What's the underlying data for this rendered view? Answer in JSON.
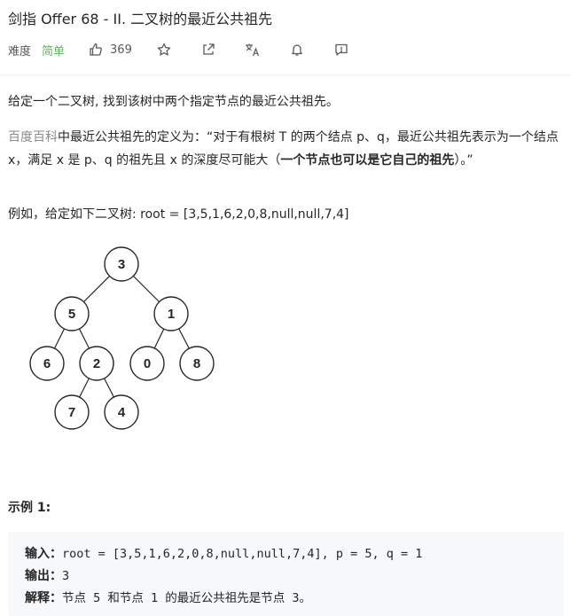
{
  "header": {
    "title": "剑指 Offer 68 - II. 二叉树的最近公共祖先",
    "difficulty_label": "难度",
    "difficulty_value": "简单",
    "likes": "369",
    "icons": [
      "thumbs-up-icon",
      "star-icon",
      "share-icon",
      "translate-icon",
      "bell-icon",
      "feedback-icon"
    ]
  },
  "description": {
    "p1": "给定一个二叉树, 找到该树中两个指定节点的最近公共祖先。",
    "p2_link": "百度百科",
    "p2_text": "中最近公共祖先的定义为：“对于有根树 T 的两个结点 p、q，最近公共祖先表示为一个结点 x，满足 x 是 p、q 的祖先且 x 的深度尽可能大（",
    "p2_bold": "一个节点也可以是它自己的祖先",
    "p2_end": "）。”",
    "p3": "例如，给定如下二叉树:  root = [3,5,1,6,2,0,8,null,null,7,4]"
  },
  "tree": {
    "nodes": [
      "3",
      "5",
      "1",
      "6",
      "2",
      "0",
      "8",
      "7",
      "4"
    ]
  },
  "example": {
    "title": "示例 1:",
    "input_label": "输入：",
    "input_value": "root = [3,5,1,6,2,0,8,null,null,7,4], p = 5, q = 1",
    "output_label": "输出：",
    "output_value": "3",
    "explain_label": "解释：",
    "explain_value": "节点 5 和节点 1 的最近公共祖先是节点 3。"
  },
  "colors": {
    "difficulty_easy": "#5cb85c",
    "link": "#8a8a8a",
    "code_bg": "#f7f8fa"
  }
}
